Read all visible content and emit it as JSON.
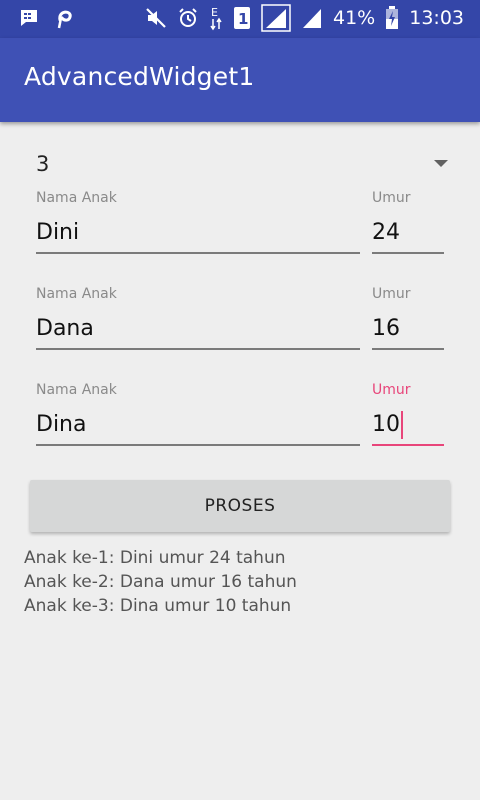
{
  "status_bar": {
    "battery": "41%",
    "time": "13:03",
    "network_letter": "E",
    "sim_number": "1",
    "left_icons": [
      "bbm-icon",
      "pinterest-icon"
    ],
    "right_icons": [
      "mute-icon",
      "alarm-icon",
      "signal-icon",
      "signal-icon",
      "battery-charging-icon"
    ]
  },
  "app_bar": {
    "title": "AdvancedWidget1"
  },
  "spinner": {
    "value": "3"
  },
  "children": [
    {
      "name_label": "Nama Anak",
      "name_value": "Dini",
      "age_label": "Umur",
      "age_value": "24"
    },
    {
      "name_label": "Nama Anak",
      "name_value": "Dana",
      "age_label": "Umur",
      "age_value": "16"
    },
    {
      "name_label": "Nama Anak",
      "name_value": "Dina",
      "age_label": "Umur",
      "age_value": "10"
    }
  ],
  "button": {
    "label": "PROSES"
  },
  "results": [
    "Anak ke-1: Dini umur 24 tahun",
    "Anak ke-2: Dana umur 16 tahun",
    "Anak ke-3: Dina umur 10 tahun"
  ],
  "colors": {
    "status_bar": "#3446a8",
    "app_bar": "#3f51b5",
    "accent": "#e8457a",
    "background": "#eeeeee"
  }
}
